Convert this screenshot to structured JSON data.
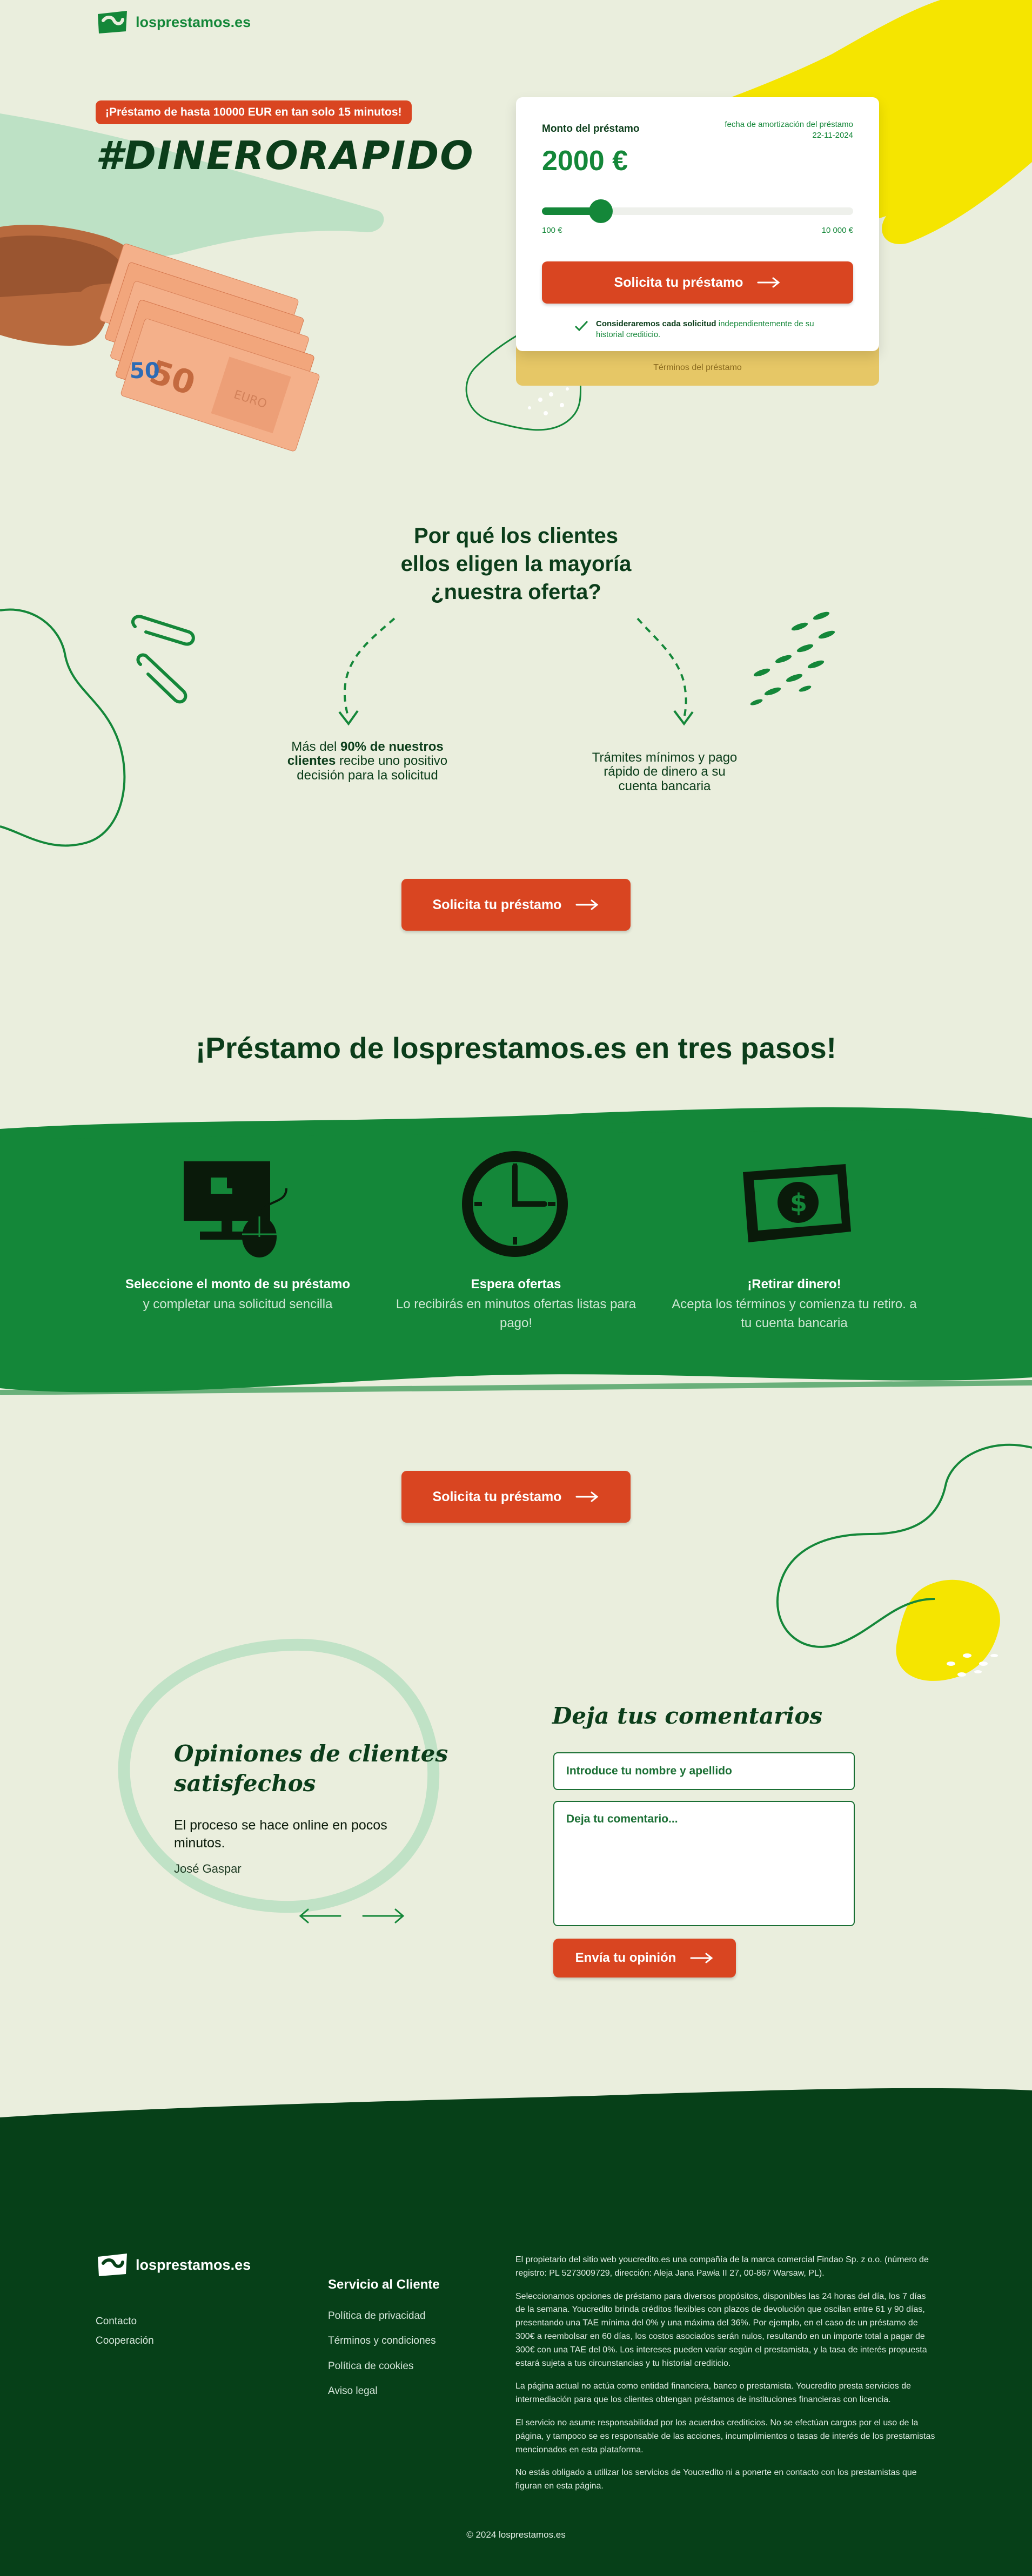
{
  "colors": {
    "brand_green": "#0b3d1a",
    "accent_green": "#148739",
    "orange": "#d94521",
    "yellow": "#f5e500",
    "background": "#eaeedd",
    "footer_bg": "#064018"
  },
  "header": {
    "logo_text": "losprestamos.es"
  },
  "hero": {
    "promo": "¡Préstamo de hasta 10000 EUR en tan solo 15 minutos!",
    "hashtag": "#DINERORAPIDO"
  },
  "calculator": {
    "label": "Monto del préstamo",
    "date_label": "fecha de amortización del préstamo",
    "date_value": "22-11-2024",
    "amount": "2000 €",
    "slider_value_fraction": 0.19,
    "min": "100 €",
    "max": "10 000 €",
    "button": "Solicita tu préstamo",
    "note_bold": "Consideraremos cada solicitud",
    "note_rest": " independientemente de su historial crediticio.",
    "terms": "Términos del préstamo"
  },
  "why": {
    "title_lines": [
      "Por qué los clientes",
      "ellos eligen la mayoría",
      "¿nuestra oferta?"
    ],
    "left_pre": "Más del ",
    "left_bold": "90% de nuestros clientes",
    "left_post": " recibe uno positivo decisión para la solicitud",
    "right": "Trámites mínimos y pago rápido de dinero a su cuenta bancaria",
    "button": "Solicita tu préstamo"
  },
  "steps": {
    "title": "¡Préstamo de losprestamos.es en tres pasos!",
    "items": [
      {
        "icon": "computer-icon",
        "title": "Seleccione el monto de su préstamo",
        "text": "y completar una solicitud sencilla"
      },
      {
        "icon": "clock-icon",
        "title": "Espera ofertas",
        "text": "Lo recibirás en minutos ofertas listas para pago!"
      },
      {
        "icon": "money-icon",
        "title": "¡Retirar dinero!",
        "text": "Acepta los términos y comienza tu retiro. a tu cuenta bancaria"
      }
    ],
    "button": "Solicita tu préstamo"
  },
  "reviews": {
    "title": "Opiniones de clientes satisfechos",
    "quote": "El proceso se hace online en pocos minutos.",
    "author": "José Gaspar"
  },
  "comment": {
    "title": "Deja tus comentarios",
    "name_placeholder": "Introduce tu nombre y apellido",
    "comment_placeholder": "Deja tu comentario...",
    "button": "Envía tu opinión"
  },
  "footer": {
    "logo_text": "losprestamos.es",
    "links_left": [
      "Contacto",
      "Cooperación"
    ],
    "service_title": "Servicio al Cliente",
    "service_links": [
      "Política de privacidad",
      "Términos y condiciones",
      "Política de cookies",
      "Aviso legal"
    ],
    "paragraphs": [
      "El propietario del sitio web youcredito.es una compañía de la marca comercial Findao Sp. z o.o. (número de registro: PL 5273009729, dirección: Aleja Jana Pawła II 27, 00-867 Warsaw, PL).",
      "Seleccionamos opciones de préstamo para diversos propósitos, disponibles las 24 horas del día, los 7 días de la semana. Youcredito brinda créditos flexibles con plazos de devolución que oscilan entre 61 y 90 días, presentando una TAE mínima del 0% y una máxima del 36%. Por ejemplo, en el caso de un préstamo de 300€ a reembolsar en 60 días, los costos asociados serán nulos, resultando en un importe total a pagar de 300€ con una TAE del 0%. Los intereses pueden variar según el prestamista, y la tasa de interés propuesta estará sujeta a tus circunstancias y tu historial crediticio.",
      "La página actual no actúa como entidad financiera, banco o prestamista. Youcredito presta servicios de intermediación para que los clientes obtengan préstamos de instituciones financieras con licencia.",
      "El servicio no asume responsabilidad por los acuerdos crediticios. No se efectúan cargos por el uso de la página, y tampoco se es responsable de las acciones, incumplimientos o tasas de interés de los prestamistas mencionados en esta plataforma.",
      "No estás obligado a utilizar los servicios de Youcredito ni a ponerte en contacto con los prestamistas que figuran en esta página."
    ],
    "copyright": "© 2024 losprestamos.es"
  }
}
